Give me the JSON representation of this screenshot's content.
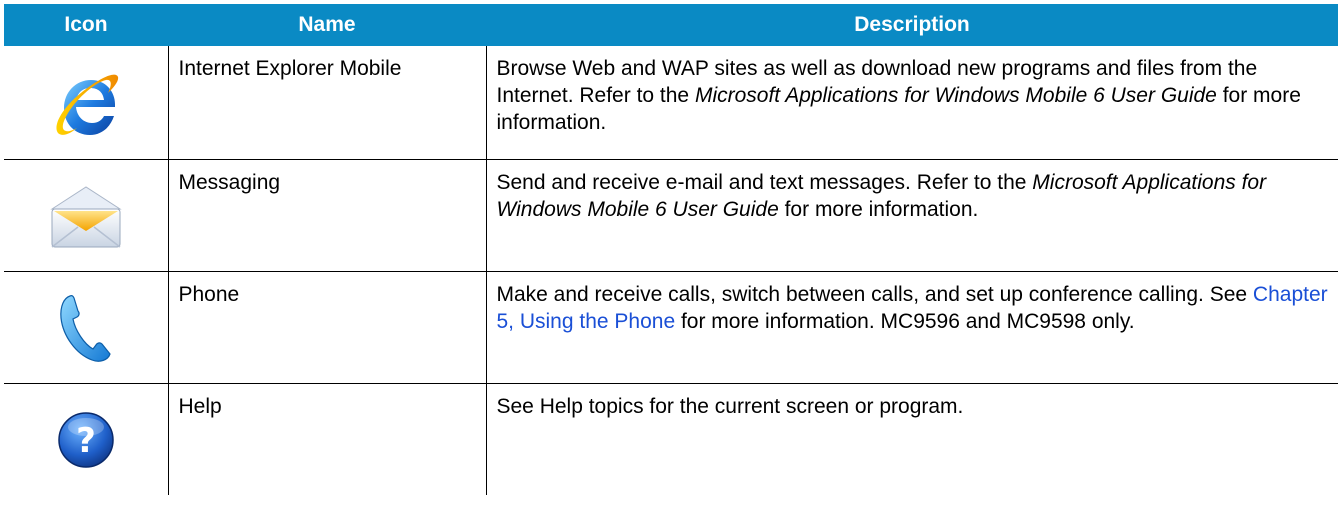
{
  "table": {
    "headers": {
      "icon": "Icon",
      "name": "Name",
      "description": "Description"
    },
    "rows": [
      {
        "icon": "internet-explorer-icon",
        "name": "Internet Explorer Mobile",
        "desc_1": "Browse Web and WAP sites as well as download new programs and files from the Internet. Refer to the ",
        "desc_em": "Microsoft Applications for Windows Mobile 6 User Guide",
        "desc_2": " for more information."
      },
      {
        "icon": "messaging-envelope-icon",
        "name": "Messaging",
        "desc_1": "Send and receive e-mail and text messages. Refer to the ",
        "desc_em": "Microsoft Applications for Windows Mobile 6 User Guide",
        "desc_2": " for more information."
      },
      {
        "icon": "phone-handset-icon",
        "name": "Phone",
        "desc_1": "Make and receive calls, switch between calls, and set up conference calling. See ",
        "desc_link": "Chapter 5, Using the Phone",
        "desc_2": " for more information. MC9596 and MC9598 only."
      },
      {
        "icon": "help-question-icon",
        "name": "Help",
        "desc_1": "See Help topics for the current screen or program."
      }
    ]
  },
  "colors": {
    "header_bg": "#0a8ac4",
    "header_text": "#ffffff",
    "link": "#1a4fd6"
  }
}
